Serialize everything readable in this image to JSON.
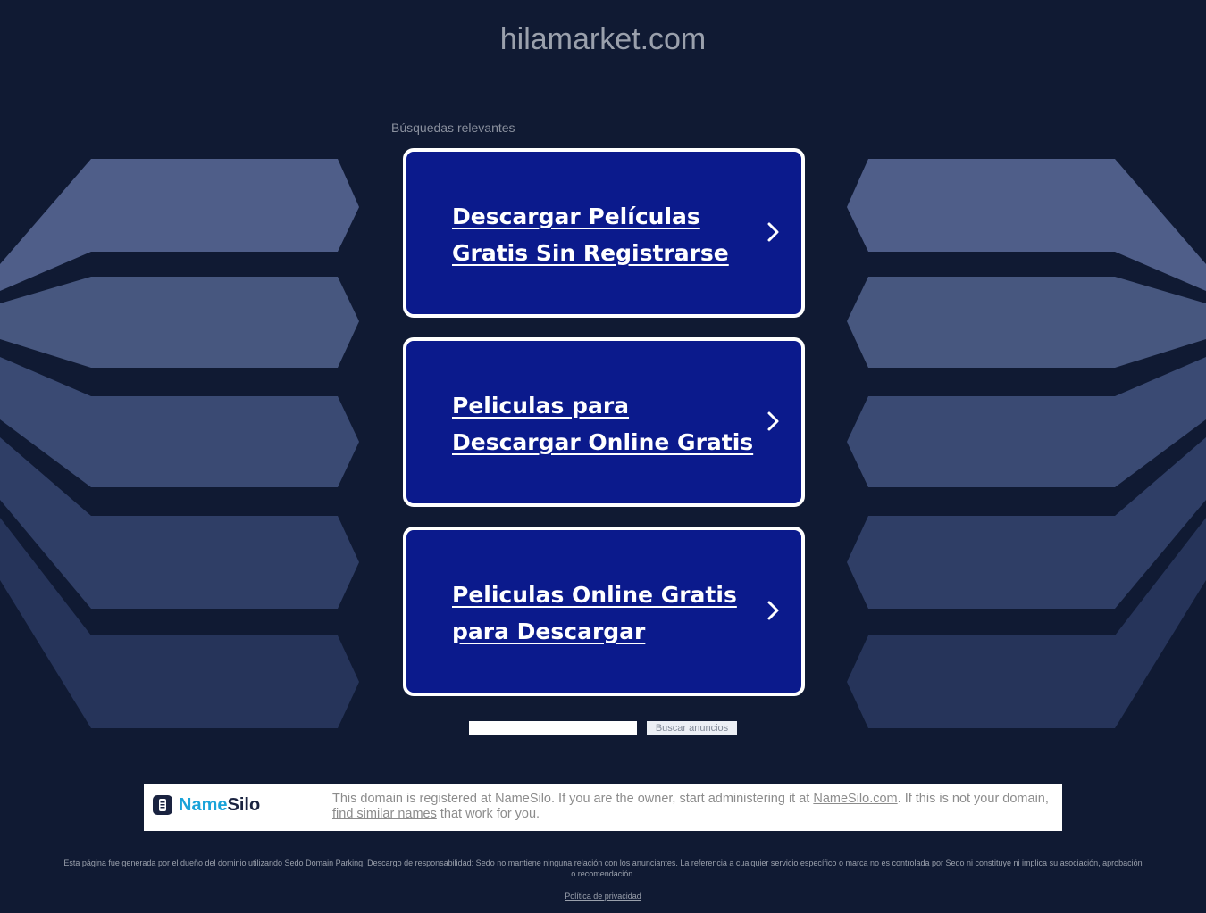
{
  "header": {
    "domain": "hilamarket.com"
  },
  "related": {
    "label": "Búsquedas relevantes",
    "links": [
      {
        "label": "Descargar Películas Gratis Sin Registrarse"
      },
      {
        "label": "Peliculas para Descargar Online Gratis"
      },
      {
        "label": "Peliculas Online Gratis para Descargar"
      }
    ]
  },
  "search": {
    "input_value": "",
    "button_label": "Buscar anuncios"
  },
  "namesilo": {
    "logo_name": "Name",
    "logo_silo": "Silo",
    "text_1": "This domain is registered at NameSilo. If you are the owner, start administering it at ",
    "link_1": "NameSilo.com",
    "text_2": ". If this is not your domain, ",
    "link_2": "find similar names",
    "text_3": " that work for you."
  },
  "footer": {
    "disclaimer_1": "Esta página fue generada por el dueño del dominio utilizando ",
    "disclaimer_link": "Sedo Domain Parking",
    "disclaimer_2": ". Descargo de responsabilidad: Sedo no mantiene ninguna relación con los anunciantes. La referencia a cualquier servicio específico o marca no es controlada por Sedo ni constituye ni implica su asociación, aprobación o recomendación.",
    "privacy_label": "Política de privacidad"
  },
  "colors": {
    "background": "#101a33",
    "card": "#0b1a8c",
    "card_border": "#ffffff",
    "namesilo_blue": "#1aa3d9"
  }
}
